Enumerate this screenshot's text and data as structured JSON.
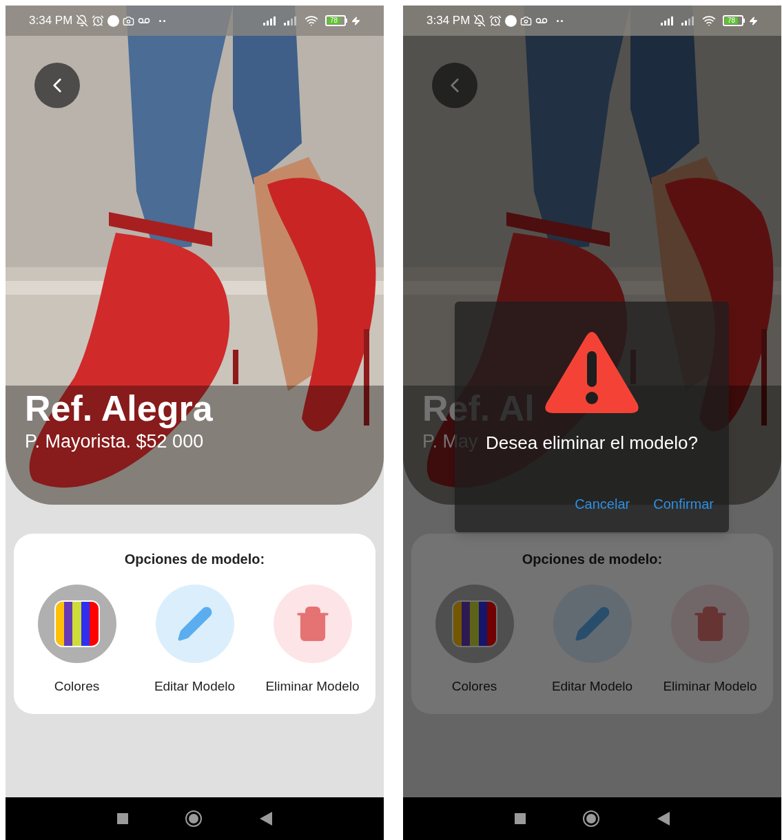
{
  "screens": [
    {
      "status_bar": {
        "time": "3:34 PM",
        "battery": "78"
      },
      "title": "Ref. Alegra",
      "price": "P. Mayorista. $52 000",
      "options": {
        "heading": "Opciones de modelo:",
        "items": [
          {
            "kind": "colors",
            "label": "Colores"
          },
          {
            "kind": "edit",
            "label": "Editar Modelo"
          },
          {
            "kind": "delete",
            "label": "Eliminar Modelo"
          }
        ]
      }
    },
    {
      "status_bar": {
        "time": "3:34 PM",
        "battery": "78"
      },
      "title": "Ref. Al",
      "price": "P. May",
      "options": {
        "heading": "Opciones de modelo:",
        "items": [
          {
            "kind": "colors",
            "label": "Colores"
          },
          {
            "kind": "edit",
            "label": "Editar Modelo"
          },
          {
            "kind": "delete",
            "label": "Eliminar Modelo"
          }
        ]
      },
      "dialog": {
        "message": "Desea eliminar el modelo?",
        "buttons": [
          "Cancelar",
          "Confirmar"
        ]
      }
    }
  ]
}
